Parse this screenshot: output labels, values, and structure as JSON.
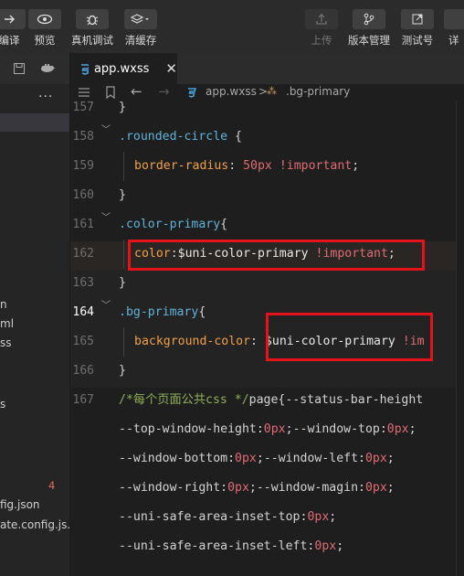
{
  "toolbar": {
    "left_items": [
      {
        "label": "编译",
        "icon": "compile-icon"
      },
      {
        "label": "预览",
        "icon": "eye-icon"
      },
      {
        "label": "真机调试",
        "icon": "bug-icon"
      },
      {
        "label": "清缓存",
        "icon": "layers-icon"
      }
    ],
    "right_items": [
      {
        "label": "上传",
        "icon": "upload-icon",
        "disabled": true
      },
      {
        "label": "版本管理",
        "icon": "branch-icon"
      },
      {
        "label": "测试号",
        "icon": "external-link-icon"
      },
      {
        "label": "详",
        "icon": "details-icon"
      }
    ]
  },
  "sidebar": {
    "more_label": "...",
    "files": [
      "n",
      "ml",
      "ss",
      "s",
      "fig.json",
      "ate.config.js..."
    ],
    "badge": "4"
  },
  "tabs": [
    {
      "label": "app.wxss",
      "close": "✕",
      "icon": "css-file-icon"
    }
  ],
  "breadcrumb": {
    "file": "app.wxss",
    "separator": ">",
    "symbol": ".bg-primary"
  },
  "editor": {
    "line_numbers": [
      "157",
      "158",
      "159",
      "160",
      "161",
      "162",
      "163",
      "164",
      "165",
      "166",
      "167",
      "",
      "",
      "",
      "",
      ""
    ],
    "active_line": "164",
    "code": {
      "l157": "}",
      "l158_selector": ".rounded-circle",
      "l158_brace": " {",
      "l159_prop": "border-radius",
      "l159_colon": ": ",
      "l159_value": "50px",
      "l159_imp": " !important",
      "l159_semi": ";",
      "l160": "}",
      "l161_selector": ".color-primary",
      "l161_brace": "{",
      "l162_prop": "color",
      "l162_colon": ":",
      "l162_var": "$uni-color-primary",
      "l162_imp": " !important",
      "l162_semi": ";",
      "l163": "}",
      "l164_selector": ".bg-primary",
      "l164_brace": "{",
      "l165_prop": "background-color",
      "l165_colon": ": ",
      "l165_var": "$uni-color-primary",
      "l165_imp": " !im",
      "l166": "}",
      "l167_comment": "/*每个页面公共css */",
      "l167_rest": "page{--status-bar-height",
      "w1": "--top-window-height:",
      "w1v": "0px",
      "w1b": ";--window-top:",
      "w1v2": "0px",
      "w1e": ";",
      "w2": "--window-bottom:",
      "w2v": "0px",
      "w2b": ";--window-left:",
      "w2v2": "0px",
      "w2e": ";",
      "w3": "--window-right:",
      "w3v": "0px",
      "w3b": ";--window-magin:",
      "w3v2": "0px",
      "w3e": ";",
      "w4": "--uni-safe-area-inset-top:",
      "w4v": "0px",
      "w4e": ";",
      "w5": "--uni-safe-area-inset-left:",
      "w5v": "0px",
      "w5e": ";"
    }
  },
  "colors": {
    "selector": "#5fb3d9",
    "property": "#f0a14a",
    "number": "#e06c75",
    "comment": "#8fb05a",
    "highlight_box": "#e3121b"
  }
}
